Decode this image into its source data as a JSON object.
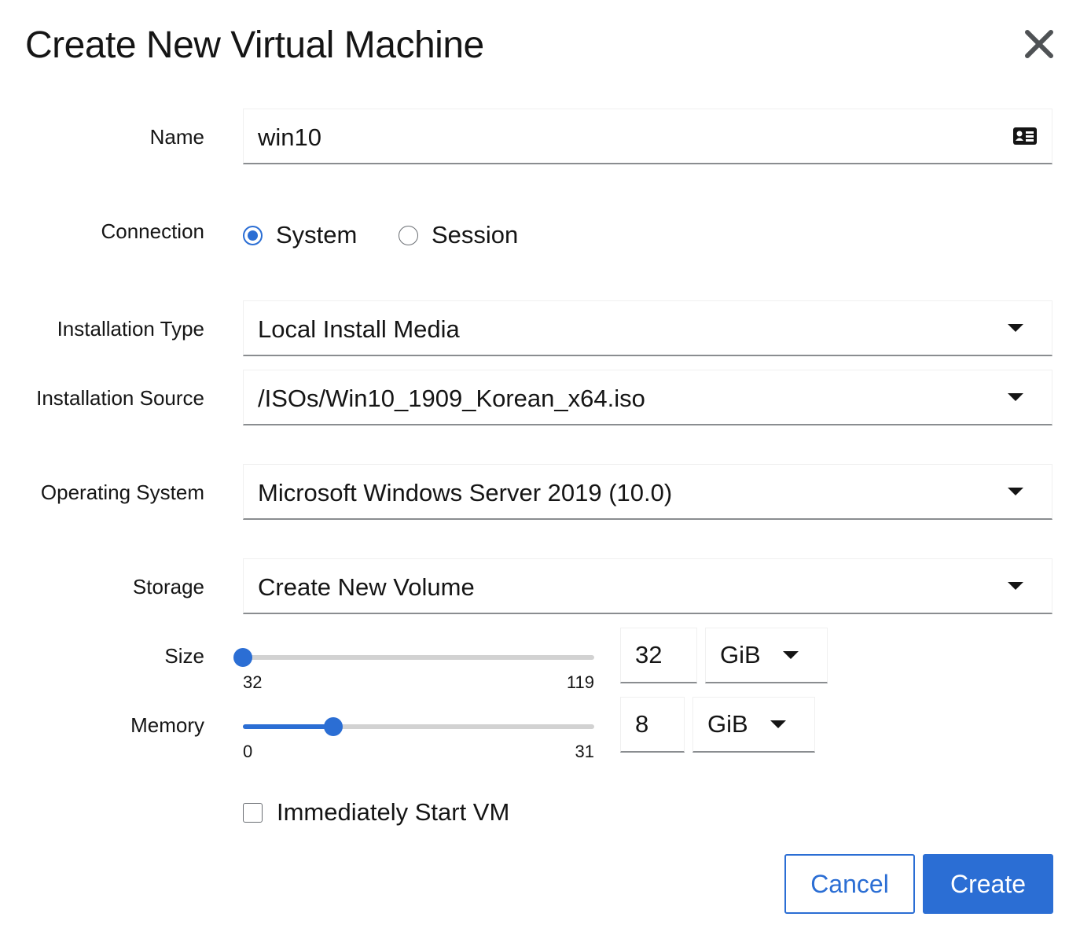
{
  "dialog": {
    "title": "Create New Virtual Machine",
    "close_icon": "close-icon"
  },
  "form": {
    "name": {
      "label": "Name",
      "value": "win10",
      "icon": "id-card-icon"
    },
    "connection": {
      "label": "Connection",
      "options": [
        {
          "label": "System",
          "selected": true
        },
        {
          "label": "Session",
          "selected": false
        }
      ]
    },
    "installation_type": {
      "label": "Installation Type",
      "value": "Local Install Media"
    },
    "installation_source": {
      "label": "Installation Source",
      "value": "/ISOs/Win10_1909_Korean_x64.iso"
    },
    "operating_system": {
      "label": "Operating System",
      "value": "Microsoft Windows Server 2019 (10.0)"
    },
    "storage": {
      "label": "Storage",
      "value": "Create New Volume"
    },
    "size": {
      "label": "Size",
      "min": "32",
      "max": "119",
      "value": "32",
      "unit": "GiB",
      "level_fraction": 0.0
    },
    "memory": {
      "label": "Memory",
      "min": "0",
      "max": "31",
      "value": "8",
      "unit": "GiB",
      "level_fraction": 0.258
    },
    "start_vm": {
      "label": "Immediately Start VM",
      "checked": false
    }
  },
  "actions": {
    "cancel_label": "Cancel",
    "create_label": "Create"
  },
  "colors": {
    "accent": "#2b6ed4",
    "text": "#151515",
    "border": "#8a8d90"
  }
}
